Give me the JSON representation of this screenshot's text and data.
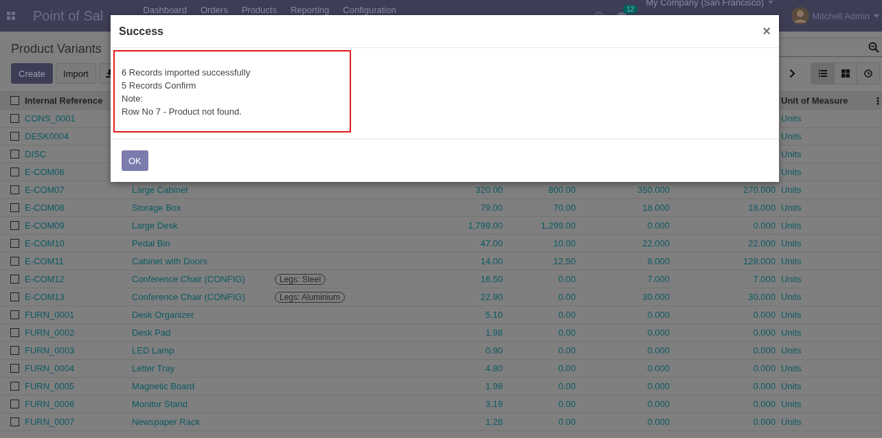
{
  "navbar": {
    "app_name": "Point of Sal",
    "menu": [
      "Dashboard",
      "Orders",
      "Products",
      "Reporting",
      "Configuration"
    ],
    "messages_badge": "12",
    "company": "My Company (San Francisco)",
    "user": "Mitchell Admin"
  },
  "control_panel": {
    "breadcrumb": "Product Variants",
    "buttons": [
      {
        "label": "Create",
        "kind": "primary"
      },
      {
        "label": "Import",
        "kind": "secondary"
      },
      {
        "kind": "download"
      }
    ],
    "views": [
      {
        "kind": "list",
        "selected": true
      },
      {
        "kind": "kanban",
        "selected": false
      },
      {
        "kind": "activity",
        "selected": false
      }
    ]
  },
  "table": {
    "header": {
      "checked": false,
      "reference": "Internal Reference",
      "unit": "Unit of Measure"
    },
    "rows": [
      {
        "checked": false,
        "reference": "CONS_0001",
        "unit": "Units"
      },
      {
        "checked": false,
        "reference": "DESK0004",
        "unit": "Units"
      },
      {
        "checked": false,
        "reference": "DISC",
        "unit": "Units"
      },
      {
        "checked": false,
        "reference": "E-COM06",
        "unit": "Units"
      },
      {
        "checked": false,
        "reference": "E-COM07",
        "name": "Large Cabinet",
        "sales_price": "320.00",
        "cost": "800.00",
        "on_hand": "350.000",
        "forecasted": "270.000",
        "unit": "Units"
      },
      {
        "checked": false,
        "reference": "E-COM08",
        "name": "Storage Box",
        "sales_price": "79.00",
        "cost": "70.00",
        "on_hand": "18.000",
        "forecasted": "18.000",
        "unit": "Units"
      },
      {
        "checked": false,
        "reference": "E-COM09",
        "name": "Large Desk",
        "sales_price": "1,799.00",
        "cost": "1,299.00",
        "on_hand": "0.000",
        "forecasted": "0.000",
        "unit": "Units"
      },
      {
        "checked": false,
        "reference": "E-COM10",
        "name": "Pedal Bin",
        "sales_price": "47.00",
        "cost": "10.00",
        "on_hand": "22.000",
        "forecasted": "22.000",
        "unit": "Units"
      },
      {
        "checked": false,
        "reference": "E-COM11",
        "name": "Cabinet with Doors",
        "sales_price": "14.00",
        "cost": "12.50",
        "on_hand": "8.000",
        "forecasted": "128.000",
        "unit": "Units"
      },
      {
        "checked": false,
        "reference": "E-COM12",
        "name": "Conference Chair (CONFIG)",
        "attribute": "Legs: Steel",
        "sales_price": "16.50",
        "cost": "0.00",
        "on_hand": "7.000",
        "forecasted": "7.000",
        "unit": "Units"
      },
      {
        "checked": false,
        "reference": "E-COM13",
        "name": "Conference Chair (CONFIG)",
        "attribute": "Legs: Aluminium",
        "sales_price": "22.90",
        "cost": "0.00",
        "on_hand": "30.000",
        "forecasted": "30.000",
        "unit": "Units"
      },
      {
        "checked": false,
        "reference": "FURN_0001",
        "name": "Desk Organizer",
        "sales_price": "5.10",
        "cost": "0.00",
        "on_hand": "0.000",
        "forecasted": "0.000",
        "unit": "Units"
      },
      {
        "checked": false,
        "reference": "FURN_0002",
        "name": "Desk Pad",
        "sales_price": "1.98",
        "cost": "0.00",
        "on_hand": "0.000",
        "forecasted": "0.000",
        "unit": "Units"
      },
      {
        "checked": false,
        "reference": "FURN_0003",
        "name": "LED Lamp",
        "sales_price": "0.90",
        "cost": "0.00",
        "on_hand": "0.000",
        "forecasted": "0.000",
        "unit": "Units"
      },
      {
        "checked": false,
        "reference": "FURN_0004",
        "name": "Letter Tray",
        "sales_price": "4.80",
        "cost": "0.00",
        "on_hand": "0.000",
        "forecasted": "0.000",
        "unit": "Units"
      },
      {
        "checked": false,
        "reference": "FURN_0005",
        "name": "Magnetic Board",
        "sales_price": "1.98",
        "cost": "0.00",
        "on_hand": "0.000",
        "forecasted": "0.000",
        "unit": "Units"
      },
      {
        "checked": false,
        "reference": "FURN_0006",
        "name": "Monitor Stand",
        "sales_price": "3.19",
        "cost": "0.00",
        "on_hand": "0.000",
        "forecasted": "0.000",
        "unit": "Units"
      },
      {
        "checked": false,
        "reference": "FURN_0007",
        "name": "Newspaper Rack",
        "sales_price": "1.28",
        "cost": "0.00",
        "on_hand": "0.000",
        "forecasted": "0.000",
        "unit": "Units"
      }
    ]
  },
  "dialog": {
    "title": "Success",
    "close": "×",
    "message_lines": [
      "6 Records imported successfully",
      "5 Records Confirm",
      "Note:",
      "Row No 7  - Product not found."
    ],
    "buttons": [
      "OK"
    ]
  }
}
